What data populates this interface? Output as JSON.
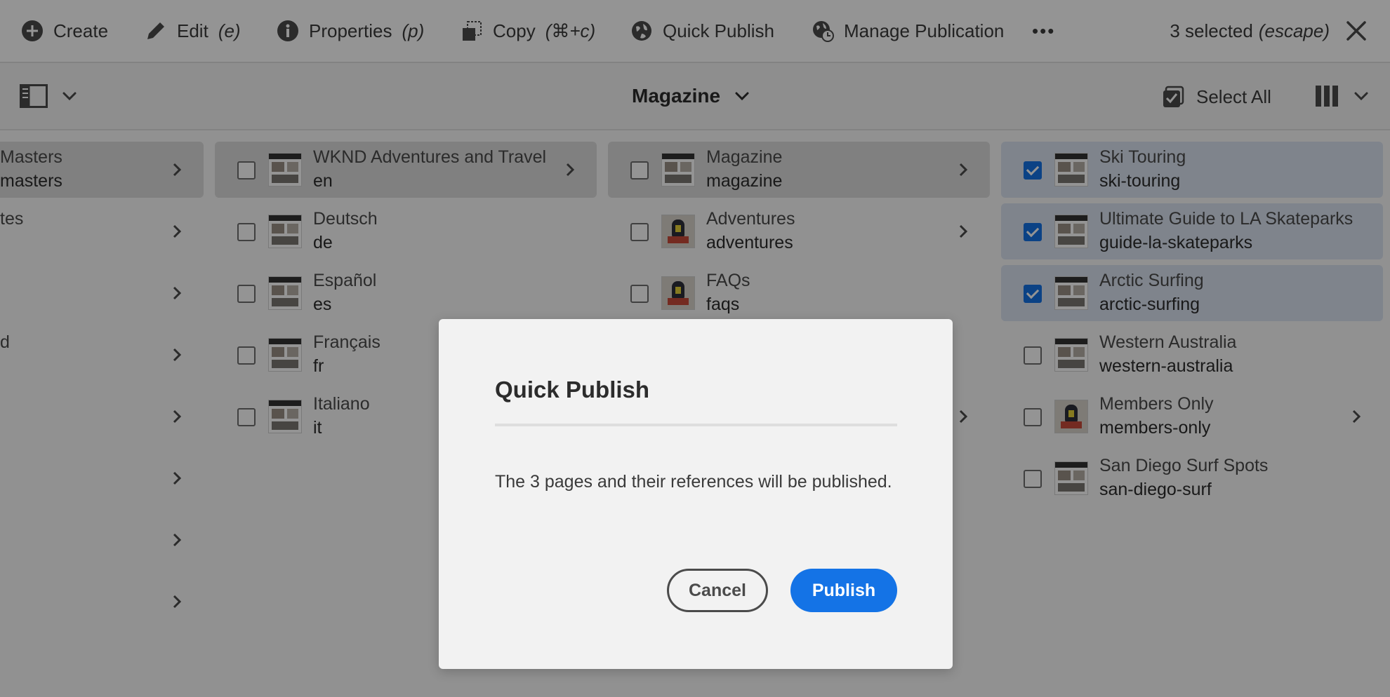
{
  "actionbar": {
    "create": "Create",
    "edit": "Edit",
    "edit_shortcut": "(e)",
    "properties": "Properties",
    "properties_shortcut": "(p)",
    "copy": "Copy",
    "copy_shortcut": "(⌘+c)",
    "quick_publish": "Quick Publish",
    "manage_publication": "Manage Publication",
    "more": "•••",
    "selected_count": "3 selected",
    "escape_hint": "(escape)"
  },
  "header": {
    "title": "Magazine",
    "select_all": "Select All"
  },
  "column1": [
    {
      "title": "Masters",
      "sub": "masters"
    },
    {
      "title": "tes",
      "sub": ""
    },
    {
      "title": "",
      "sub": ""
    },
    {
      "title": "d",
      "sub": ""
    },
    {
      "title": "",
      "sub": ""
    },
    {
      "title": "",
      "sub": ""
    },
    {
      "title": "",
      "sub": ""
    },
    {
      "title": "",
      "sub": ""
    }
  ],
  "column2": [
    {
      "title": "WKND Adventures and Travel",
      "sub": "en"
    },
    {
      "title": "Deutsch",
      "sub": "de"
    },
    {
      "title": "Español",
      "sub": "es"
    },
    {
      "title": "Français",
      "sub": "fr"
    },
    {
      "title": "Italiano",
      "sub": "it"
    }
  ],
  "column3": [
    {
      "title": "Magazine",
      "sub": "magazine"
    },
    {
      "title": "Adventures",
      "sub": "adventures"
    },
    {
      "title": "FAQs",
      "sub": "faqs"
    }
  ],
  "column4": [
    {
      "title": "Ski Touring",
      "sub": "ski-touring",
      "checked": true
    },
    {
      "title": "Ultimate Guide to LA Skateparks",
      "sub": "guide-la-skateparks",
      "checked": true
    },
    {
      "title": "Arctic Surfing",
      "sub": "arctic-surfing",
      "checked": true
    },
    {
      "title": "Western Australia",
      "sub": "western-australia",
      "checked": false
    },
    {
      "title": "Members Only",
      "sub": "members-only",
      "checked": false
    },
    {
      "title": "San Diego Surf Spots",
      "sub": "san-diego-surf",
      "checked": false
    }
  ],
  "dialog": {
    "title": "Quick Publish",
    "body": "The 3 pages and their references will be published.",
    "cancel": "Cancel",
    "publish": "Publish"
  },
  "colors": {
    "accent": "#1473e6",
    "selected_row": "#dbe4f2",
    "active_row": "#dcdcdc"
  }
}
